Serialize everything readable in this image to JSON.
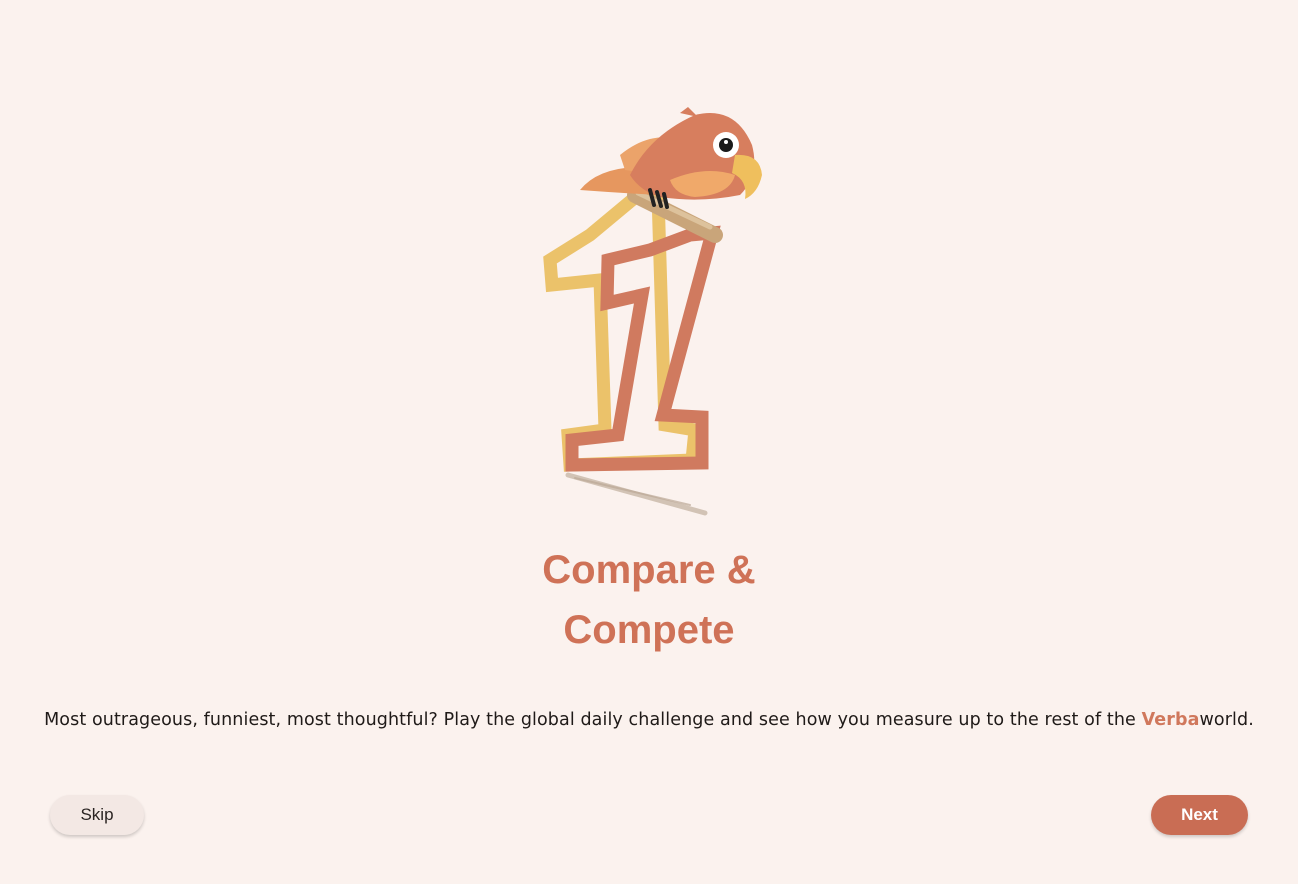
{
  "onboarding": {
    "title_line1": "Compare &",
    "title_line2": "Compete",
    "description_text": "Most outrageous, funniest, most thoughtful? Play the global daily challenge and see how you measure up to the rest of the ",
    "brand_name": "Verba",
    "description_suffix": "world."
  },
  "buttons": {
    "skip_label": "Skip",
    "next_label": "Next"
  },
  "colors": {
    "background": "#fbf2ee",
    "accent": "#cf7257",
    "number_yellow": "#ebc26a",
    "skip_bg": "#f3e8e4"
  },
  "illustration": {
    "icon": "parrot-on-number-one-icon"
  }
}
